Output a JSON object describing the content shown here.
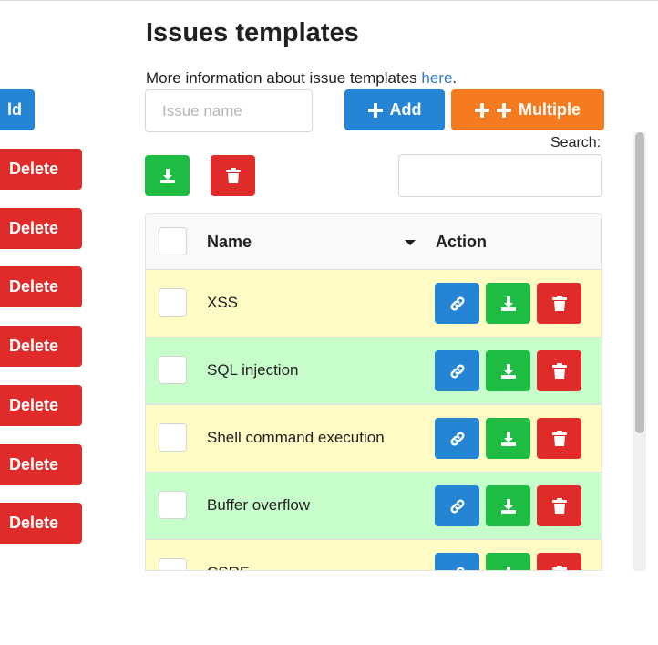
{
  "left": {
    "add_label": "ld",
    "delete_label": "Delete",
    "delete_rows": [
      185,
      249,
      314,
      379,
      444,
      508,
      573
    ]
  },
  "page": {
    "title": "Issues templates",
    "info_text": "More information about issue templates ",
    "info_link": "here",
    "info_suffix": "."
  },
  "form": {
    "name_placeholder": "Issue name",
    "add_label": "Add",
    "multiple_label": "Multiple"
  },
  "search": {
    "label": "Search:",
    "value": ""
  },
  "table": {
    "columns": {
      "name": "Name",
      "action": "Action"
    },
    "rows": [
      {
        "name": "XSS",
        "color": "#fffbc4"
      },
      {
        "name": "SQL injection",
        "color": "#c7fdca"
      },
      {
        "name": "Shell command execution",
        "color": "#fffbc4"
      },
      {
        "name": "Buffer overflow",
        "color": "#c7fdca"
      },
      {
        "name": "CSRF",
        "color": "#fffbc4"
      }
    ]
  },
  "colors": {
    "blue": "#2585d4",
    "green": "#1ebc43",
    "red": "#e02b2b",
    "orange": "#f47b20"
  },
  "icons": {
    "link": "link-icon",
    "download": "download-icon",
    "trash": "trash-icon",
    "plus": "plus-icon",
    "sort": "caret-down-icon"
  }
}
